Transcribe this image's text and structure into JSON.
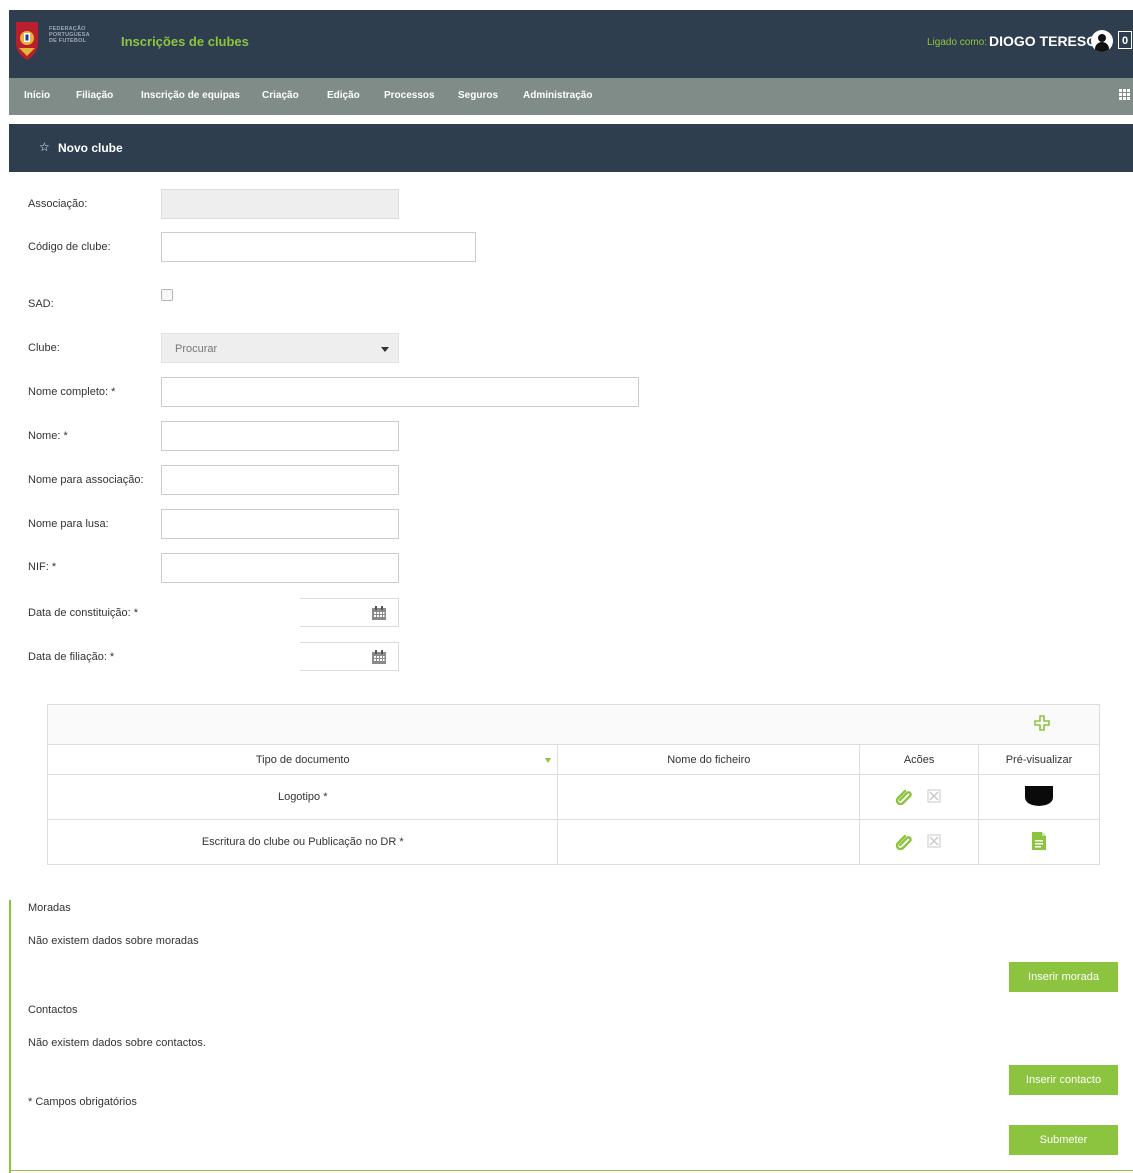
{
  "header": {
    "logo_text": [
      "FEDERAÇÃO",
      "PORTUGUESA",
      "DE FUTEBOL"
    ],
    "app_title": "Inscrições de clubes",
    "logged_label": "Ligado como:",
    "user_name": "DIOGO TERESO",
    "notifications": "0"
  },
  "nav": {
    "items": [
      "Início",
      "Filiação",
      "Inscrição de equipas",
      "Criação",
      "Edição",
      "Processos",
      "Seguros",
      "Administração"
    ]
  },
  "section": {
    "title": "Novo clube"
  },
  "form": {
    "associacao_label": "Associação:",
    "associacao_value": "",
    "codigo_label": "Código de clube:",
    "codigo_value": "",
    "sad_label": "SAD:",
    "sad_checked": false,
    "clube_label": "Clube:",
    "clube_placeholder": "Procurar",
    "nome_completo_label": "Nome completo: *",
    "nome_label": "Nome: *",
    "nome_assoc_label": "Nome para associação:",
    "nome_lusa_label": "Nome para lusa:",
    "nif_label": "NIF: *",
    "data_const_label": "Data de constituição: *",
    "data_filiacao_label": "Data de filiação: *"
  },
  "documents": {
    "headers": [
      "Tipo de documento",
      "Nome do ficheiro",
      "Acões",
      "Pré-visualizar"
    ],
    "rows": [
      {
        "tipo": "Logotipo *",
        "ficheiro": ""
      },
      {
        "tipo": "Escritura do clube ou Publicação no DR *",
        "ficheiro": ""
      }
    ]
  },
  "moradas": {
    "title": "Moradas",
    "empty": "Não existem dados sobre moradas",
    "button": "Inserir morada"
  },
  "contactos": {
    "title": "Contactos",
    "empty": "Não existem dados sobre contactos.",
    "button": "Inserir contacto"
  },
  "footer": {
    "required_note": "* Campos obrigatórios",
    "submit": "Submeter"
  },
  "colors": {
    "header_bg": "#2e3e4f",
    "nav_bg": "#7f8c88",
    "accent_green": "#8cc43f"
  }
}
